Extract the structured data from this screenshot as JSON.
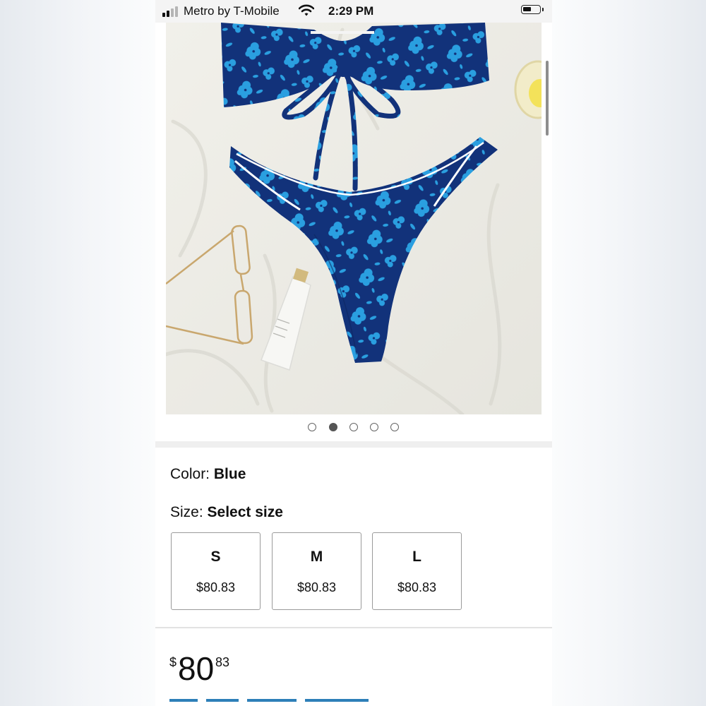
{
  "status_bar": {
    "carrier": "Metro by T-Mobile",
    "time": "2:29 PM",
    "icons": [
      "signal-icon",
      "wifi-icon",
      "battery-icon"
    ]
  },
  "product_image": {
    "carousel_pages": 5,
    "active_page": 2
  },
  "options": {
    "color_label": "Color:",
    "color_value": "Blue",
    "size_label": "Size:",
    "size_value": "Select size",
    "sizes": [
      {
        "label": "S",
        "price": "$80.83"
      },
      {
        "label": "M",
        "price": "$80.83"
      },
      {
        "label": "L",
        "price": "$80.83"
      }
    ]
  },
  "price": {
    "currency": "$",
    "whole": "80",
    "cents": "83"
  },
  "colors": {
    "print_navy": "#12327a",
    "print_blue": "#2a9fe0",
    "link_blue": "#2d7fb8"
  }
}
